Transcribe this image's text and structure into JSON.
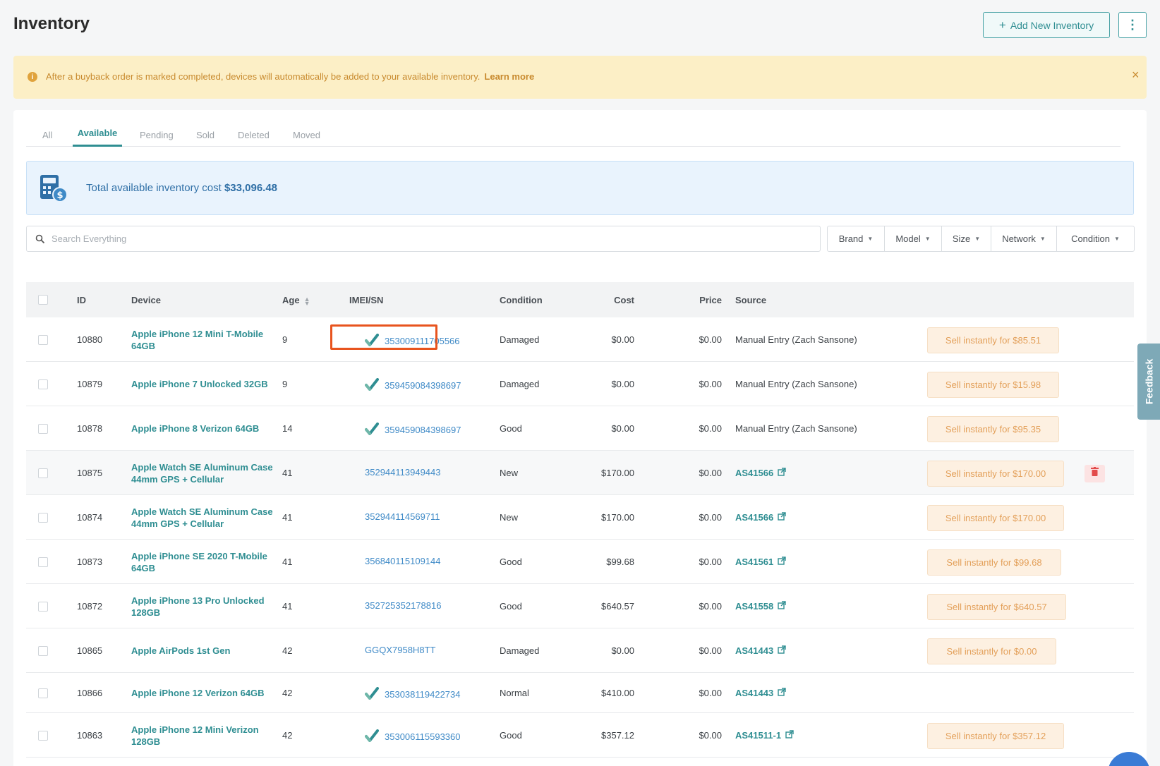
{
  "header": {
    "title": "Inventory",
    "add_button_label": "Add New Inventory",
    "more_icon": "more-vertical-icon"
  },
  "banner": {
    "message": "After a buyback order is marked completed, devices will automatically be added to your available inventory.",
    "link": "Learn more",
    "close_glyph": "×"
  },
  "tabs": [
    {
      "label": "All"
    },
    {
      "label": "Available",
      "active": true
    },
    {
      "label": "Pending"
    },
    {
      "label": "Sold"
    },
    {
      "label": "Deleted"
    },
    {
      "label": "Moved"
    }
  ],
  "summary": {
    "label": "Total available inventory cost",
    "amount": "$33,096.48"
  },
  "search": {
    "placeholder": "Search Everything",
    "value": ""
  },
  "filters": [
    {
      "label": "Brand"
    },
    {
      "label": "Model"
    },
    {
      "label": "Size"
    },
    {
      "label": "Network"
    },
    {
      "label": "Condition"
    }
  ],
  "table": {
    "headers": {
      "id": "ID",
      "device": "Device",
      "age": "Age",
      "imei": "IMEI/SN",
      "condition": "Condition",
      "cost": "Cost",
      "price": "Price",
      "source": "Source"
    },
    "rows": [
      {
        "id": "10880",
        "device_line1": "Apple iPhone 12 Mini T-Mobile",
        "device_line2": "64GB",
        "age": "9",
        "imei": "353009111705566",
        "verified": true,
        "condition": "Damaged",
        "cost": "$0.00",
        "price": "$0.00",
        "source": "Manual Entry (Zach Sansone)",
        "source_is_link": false,
        "sell_label": "Sell instantly for $85.51"
      },
      {
        "id": "10879",
        "device_line1": "Apple iPhone 7 Unlocked 32GB",
        "device_line2": "",
        "age": "9",
        "imei": "359459084398697",
        "verified": true,
        "condition": "Damaged",
        "cost": "$0.00",
        "price": "$0.00",
        "source": "Manual Entry (Zach Sansone)",
        "source_is_link": false,
        "sell_label": "Sell instantly for $15.98"
      },
      {
        "id": "10878",
        "device_line1": "Apple iPhone 8 Verizon 64GB",
        "device_line2": "",
        "age": "14",
        "imei": "359459084398697",
        "verified": true,
        "condition": "Good",
        "cost": "$0.00",
        "price": "$0.00",
        "source": "Manual Entry (Zach Sansone)",
        "source_is_link": false,
        "sell_label": "Sell instantly for $95.35"
      },
      {
        "id": "10875",
        "device_line1": "Apple Watch SE Aluminum Case",
        "device_line2": "44mm GPS + Cellular",
        "age": "41",
        "imei": "352944113949443",
        "verified": false,
        "condition": "New",
        "cost": "$170.00",
        "price": "$0.00",
        "source": "AS41566",
        "source_is_link": true,
        "sell_label": "Sell instantly for $170.00",
        "show_delete": true
      },
      {
        "id": "10874",
        "device_line1": "Apple Watch SE Aluminum Case",
        "device_line2": "44mm GPS + Cellular",
        "age": "41",
        "imei": "352944114569711",
        "verified": false,
        "condition": "New",
        "cost": "$170.00",
        "price": "$0.00",
        "source": "AS41566",
        "source_is_link": true,
        "sell_label": "Sell instantly for $170.00"
      },
      {
        "id": "10873",
        "device_line1": "Apple iPhone SE 2020 T-Mobile",
        "device_line2": "64GB",
        "age": "41",
        "imei": "356840115109144",
        "verified": false,
        "condition": "Good",
        "cost": "$99.68",
        "price": "$0.00",
        "source": "AS41561",
        "source_is_link": true,
        "sell_label": "Sell instantly for $99.68"
      },
      {
        "id": "10872",
        "device_line1": "Apple iPhone 13 Pro Unlocked",
        "device_line2": "128GB",
        "age": "41",
        "imei": "352725352178816",
        "verified": false,
        "condition": "Good",
        "cost": "$640.57",
        "price": "$0.00",
        "source": "AS41558",
        "source_is_link": true,
        "sell_label": "Sell instantly for $640.57"
      },
      {
        "id": "10865",
        "device_line1": "Apple AirPods 1st Gen",
        "device_line2": "",
        "age": "42",
        "imei": "GGQX7958H8TT",
        "verified": false,
        "condition": "Damaged",
        "cost": "$0.00",
        "price": "$0.00",
        "source": "AS41443",
        "source_is_link": true,
        "sell_label": "Sell instantly for $0.00"
      },
      {
        "id": "10866",
        "device_line1": "Apple iPhone 12 Verizon 64GB",
        "device_line2": "",
        "age": "42",
        "imei": "353038119422734",
        "verified": true,
        "condition": "Normal",
        "cost": "$410.00",
        "price": "$0.00",
        "source": "AS41443",
        "source_is_link": true,
        "sell_label": ""
      },
      {
        "id": "10863",
        "device_line1": "Apple iPhone 12 Mini Verizon",
        "device_line2": "128GB",
        "age": "42",
        "imei": "353006115593360",
        "verified": true,
        "condition": "Good",
        "cost": "$357.12",
        "price": "$0.00",
        "source": "AS41511-1",
        "source_is_link": true,
        "sell_label": "Sell instantly for $357.12"
      }
    ]
  },
  "feedback": {
    "label": "Feedback"
  },
  "colors": {
    "accent": "#2f8e92",
    "link": "#3f8ac7",
    "banner_bg": "#fcefc6",
    "sell_bg": "#fdf0e1",
    "highlight": "#e8541e"
  }
}
